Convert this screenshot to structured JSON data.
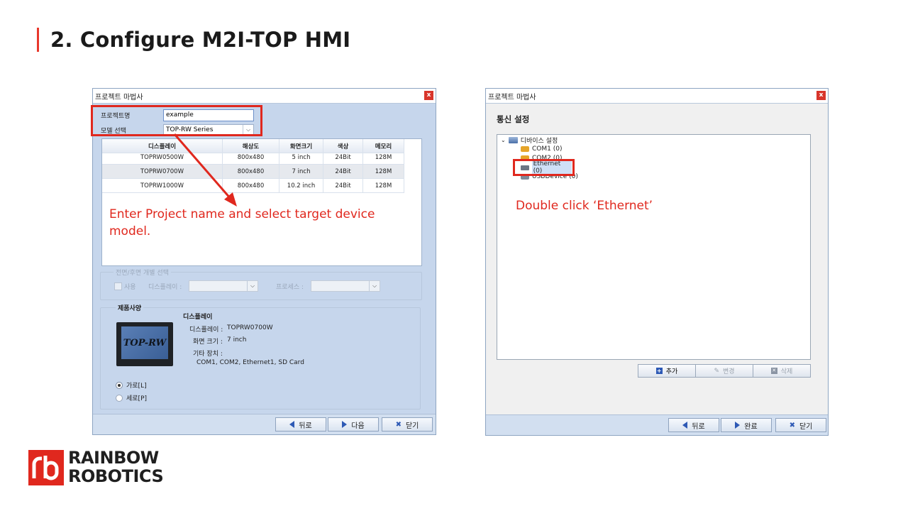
{
  "slide": {
    "title": "2. Configure M2I-TOP HMI"
  },
  "left_dialog": {
    "title": "프로젝트 마법사",
    "close": "x",
    "project_name_label": "프로젝트명",
    "project_name_value": "example",
    "model_label": "모델 선택",
    "model_value": "TOP-RW Series",
    "table": {
      "columns": [
        "디스플레이",
        "해상도",
        "화면크기",
        "색상",
        "메모리"
      ],
      "rows": [
        [
          "TOPRW0500W",
          "800x480",
          "5 inch",
          "24Bit",
          "128M"
        ],
        [
          "TOPRW0700W",
          "800x480",
          "7 inch",
          "24Bit",
          "128M"
        ],
        [
          "TOPRW1000W",
          "800x480",
          "10.2 inch",
          "24Bit",
          "128M"
        ]
      ]
    },
    "annotation": "Enter Project name and select target device model.",
    "front_rear_group": "전면/후면 개별 선택",
    "use_label": "사용",
    "display_label": "디스플레이 :",
    "process_label": "프로세스 :",
    "spec_group": "제품사양",
    "spec_heading": "디스플레이",
    "spec_display_label": "디스플레이 :",
    "spec_display_value": "TOPRW0700W",
    "spec_size_label": "화면 크기 :",
    "spec_size_value": "7 inch",
    "spec_other_label": "기타 장치 :",
    "spec_other_value": "COM1, COM2, Ethernet1, SD Card",
    "device_logo": "TOP-RW",
    "orientation_landscape": "가로[L]",
    "orientation_portrait": "세로[P]",
    "btn_back": "뒤로",
    "btn_next": "다음",
    "btn_close": "닫기"
  },
  "right_dialog": {
    "title": "프로젝트 마법사",
    "close": "x",
    "heading": "통신 설정",
    "tree_root": "디바이스 설정",
    "tree_items": [
      "COM1 (0)",
      "COM2 (0)",
      "Ethernet (0)",
      "USBDevice (0)"
    ],
    "annotation": "Double click ‘Ethernet’",
    "btn_add": "추가",
    "btn_change": "변경",
    "btn_delete": "삭제",
    "btn_back": "뒤로",
    "btn_finish": "완료",
    "btn_close": "닫기"
  },
  "brand": {
    "line1": "RAINBOW",
    "line2": "ROBOTICS",
    "color": "#e0281e"
  },
  "colors": {
    "accent_red": "#e0281e",
    "dialog_blue": "#c6d6ec"
  }
}
